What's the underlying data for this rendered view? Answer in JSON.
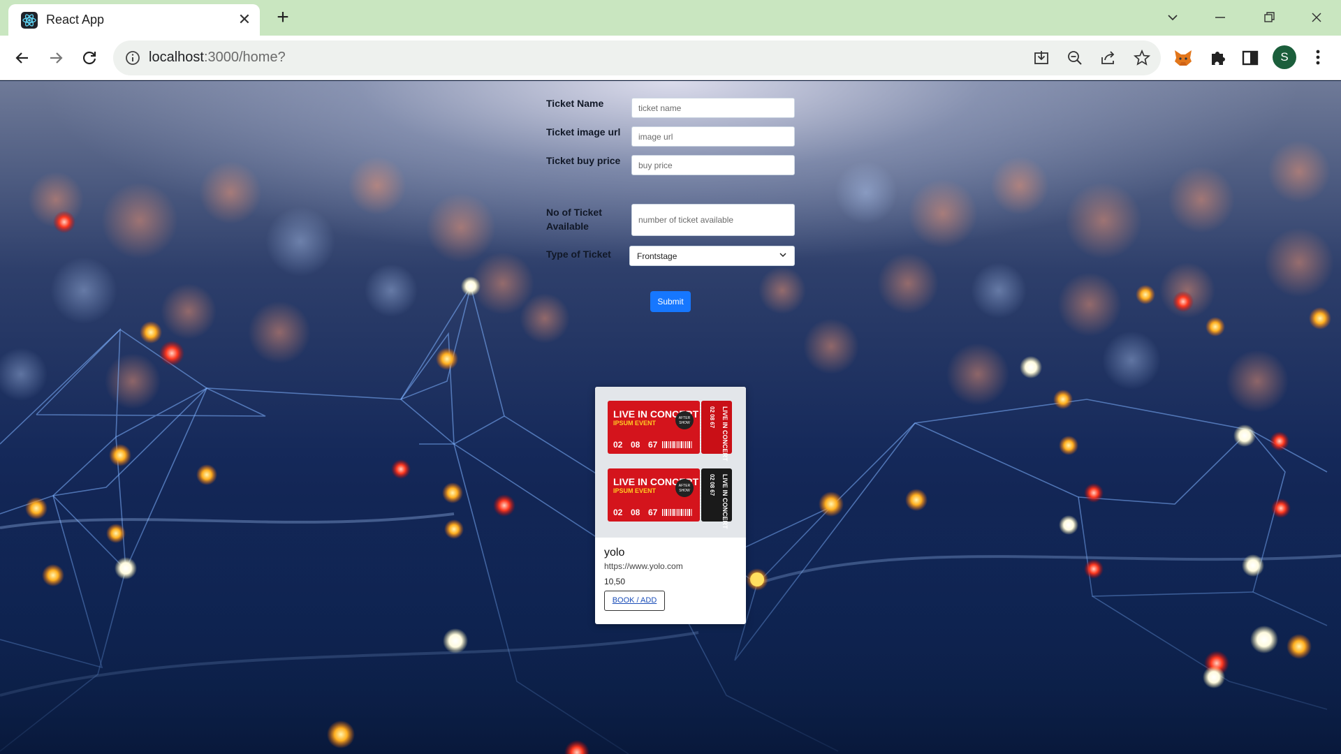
{
  "browser": {
    "tab_title": "React App",
    "tab_close": "✕",
    "new_tab": "+",
    "url_host": "localhost",
    "url_path": ":3000/home?",
    "profile_initial": "S",
    "icons": {
      "favicon": "react-logo-icon",
      "back": "back-arrow-icon",
      "forward": "forward-arrow-icon",
      "reload": "reload-icon",
      "site_info": "info-icon",
      "install": "install-app-icon",
      "zoom": "zoom-out-icon",
      "share": "share-icon",
      "bookmark": "star-icon",
      "metamask": "fox-icon",
      "extensions": "puzzle-icon",
      "side_panel": "side-panel-icon",
      "menu": "kebab-menu-icon"
    },
    "colors": {
      "tab_strip": "#c9e6c0",
      "profile": "#1b5e3b"
    }
  },
  "form": {
    "ticket_name": {
      "label": "Ticket Name",
      "placeholder": "ticket name",
      "value": ""
    },
    "image_url": {
      "label": "Ticket image url",
      "placeholder": "image url",
      "value": ""
    },
    "buy_price": {
      "label": "Ticket buy price",
      "placeholder": "buy price",
      "value": ""
    },
    "available": {
      "label_line1": "No of Ticket",
      "label_line2": "Available",
      "placeholder": "number of ticket available",
      "value": ""
    },
    "ticket_type": {
      "label": "Type of Ticket",
      "selected": "Frontstage"
    },
    "submit_label": "Submit",
    "colors": {
      "submit": "#1677ff"
    }
  },
  "card": {
    "title": "yolo",
    "url": "https://www.yolo.com",
    "price": "10,50",
    "button_label": "BOOK / ADD",
    "image": {
      "ticket_headline": "LIVE IN CONCERT",
      "ticket_subline": "IPSUM EVENT",
      "badge_line1": "AFTER",
      "badge_line2": "SHOW",
      "date_day": "02",
      "date_month": "08",
      "date_year": "67",
      "stub_text": "LIVE IN CONCERT",
      "stub_date": "02 08 67",
      "colors": {
        "ticket_red": "#d4141c",
        "stub_black": "#1a1a1a"
      }
    }
  }
}
